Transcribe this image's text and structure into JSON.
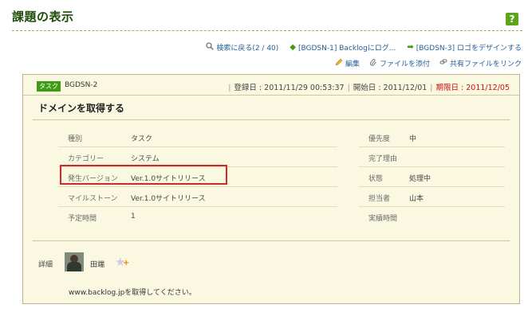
{
  "page": {
    "title": "課題の表示",
    "help_label": "?"
  },
  "nav": {
    "back_to_search": "検索に戻る(2 / 40)",
    "prev_issue": "[BGDSN-1] Backlogにログ...",
    "next_issue": "[BGDSN-3] ロゴをデザインする"
  },
  "actions": {
    "edit": "編集",
    "attach_file": "ファイルを添付",
    "link_shared_file": "共有ファイルをリンク"
  },
  "issue": {
    "type_tag": "タスク",
    "key": "BGDSN-2",
    "registered": "登録日 : 2011/11/29 00:53:37",
    "start": "開始日 : 2011/12/01",
    "due": "期限日 : 2011/12/05",
    "summary": "ドメインを取得する",
    "fields_left": [
      {
        "label": "種別",
        "value": "タスク"
      },
      {
        "label": "カテゴリー",
        "value": "システム"
      },
      {
        "label": "発生バージョン",
        "value": "Ver.1.0サイトリリース"
      },
      {
        "label": "マイルストーン",
        "value": "Ver.1.0サイトリリース"
      },
      {
        "label": "予定時間",
        "value": "1"
      }
    ],
    "fields_right": [
      {
        "label": "優先度",
        "value": "中"
      },
      {
        "label": "完了理由",
        "value": ""
      },
      {
        "label": "状態",
        "value": "処理中"
      },
      {
        "label": "担当者",
        "value": "山本"
      },
      {
        "label": "実績時間",
        "value": ""
      }
    ],
    "detail_label": "詳細",
    "author": "田端",
    "description": "www.backlog.jpを取得してください。"
  },
  "colors": {
    "accent_green": "#3e9c12",
    "due_red": "#d01010",
    "highlight_red": "#d42828",
    "panel_bg": "#fbf8e1"
  }
}
